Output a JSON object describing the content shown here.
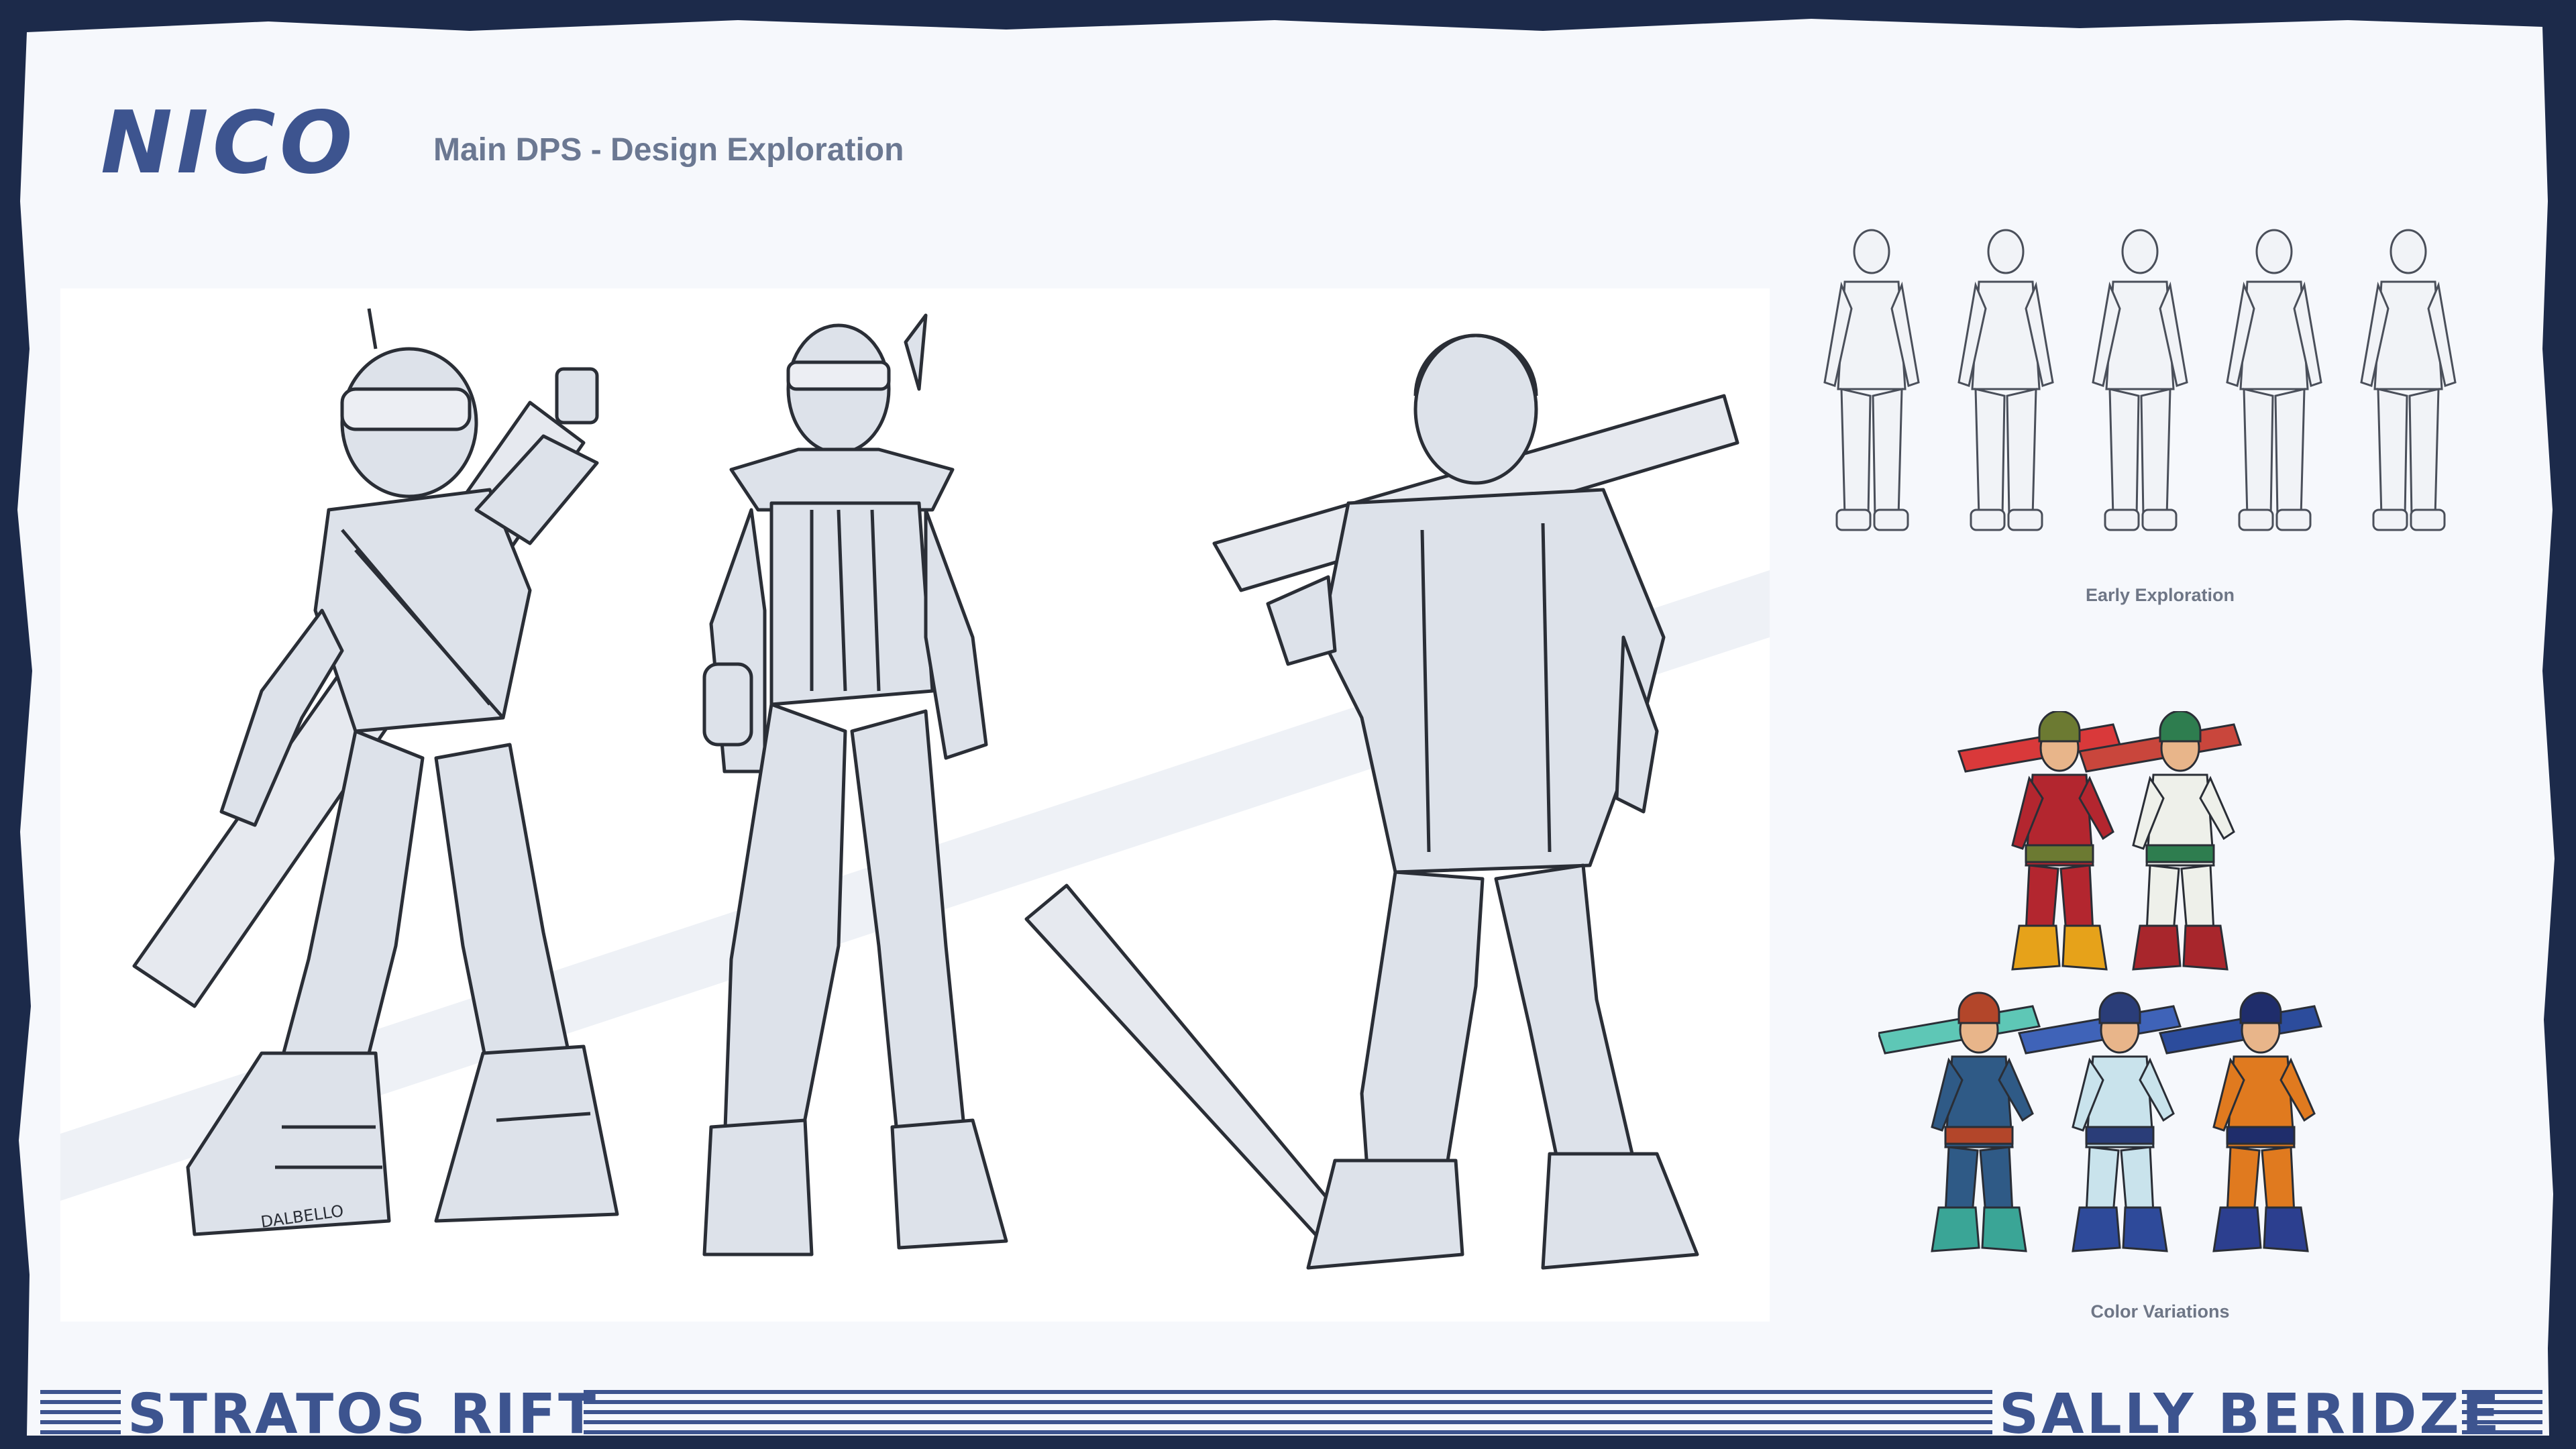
{
  "header": {
    "title": "NICO",
    "subtitle": "Main DPS - Design Exploration"
  },
  "sections": {
    "early_caption": "Early Exploration",
    "color_caption": "Color Variations"
  },
  "sketch": {
    "boot_brand": "DALBELLO"
  },
  "footer": {
    "left_brand": "STRATOS RIFT",
    "right_brand": "SALLY BERIDZE"
  },
  "colors": {
    "frame": "#1c2a4a",
    "paper": "#f6f8fc",
    "accent": "#3d548f",
    "sketch_fill": "#dde2ea",
    "ink": "#2a2e36"
  },
  "color_variants": [
    {
      "suit": "#b3262f",
      "accent": "#6c7a32",
      "boots": "#e6a21a",
      "sword": "#d9393a"
    },
    {
      "suit": "#eef0ea",
      "accent": "#2e7d4f",
      "boots": "#a8262c",
      "sword": "#c9463c"
    },
    {
      "suit": "#2f5a86",
      "accent": "#b3462a",
      "boots": "#3aa596",
      "sword": "#5ec7b6"
    },
    {
      "suit": "#c9e3ec",
      "accent": "#2a3d78",
      "boots": "#2e4a9a",
      "sword": "#3f63b8"
    },
    {
      "suit": "#e07a1f",
      "accent": "#1f2d6b",
      "boots": "#2c3f8f",
      "sword": "#2c4c9c"
    }
  ]
}
